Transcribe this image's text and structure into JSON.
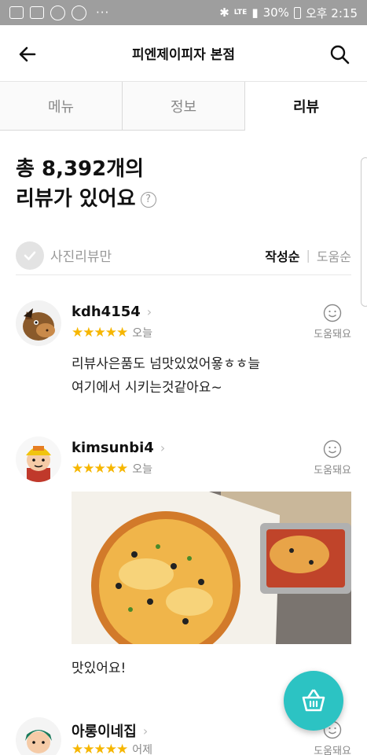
{
  "status_bar": {
    "network": "LTE",
    "battery": "30%",
    "time": "오후 2:15"
  },
  "header": {
    "title": "피엔제이피자 본점"
  },
  "tabs": [
    {
      "label": "메뉴"
    },
    {
      "label": "정보"
    },
    {
      "label": "리뷰"
    }
  ],
  "summary": {
    "line1": "총 8,392개의",
    "line2": "리뷰가 있어요",
    "help_icon": "?"
  },
  "filter": {
    "photo_only_label": "사진리뷰만",
    "sort_latest": "작성순",
    "sort_helpful": "도움순"
  },
  "reviews": [
    {
      "nickname": "kdh4154",
      "stars": "★★★★★",
      "rating": 5,
      "date": "오늘",
      "helpful_label": "도움돼요",
      "text_line1": "리뷰사은품도 넘맛있었어욯ㅎㅎ늘",
      "text_line2": "여기에서 시키는것같아요~"
    },
    {
      "nickname": "kimsunbi4",
      "stars": "★★★★★",
      "rating": 5,
      "date": "오늘",
      "helpful_label": "도움돼요",
      "text": "맛있어요!"
    },
    {
      "nickname": "아롱이네집",
      "stars": "★★★★★",
      "rating": 5,
      "date": "어제",
      "helpful_label": "도움돼요"
    }
  ],
  "colors": {
    "accent": "#2cc3c3",
    "star": "#f6b600",
    "status_bar": "#9e9e9e"
  }
}
